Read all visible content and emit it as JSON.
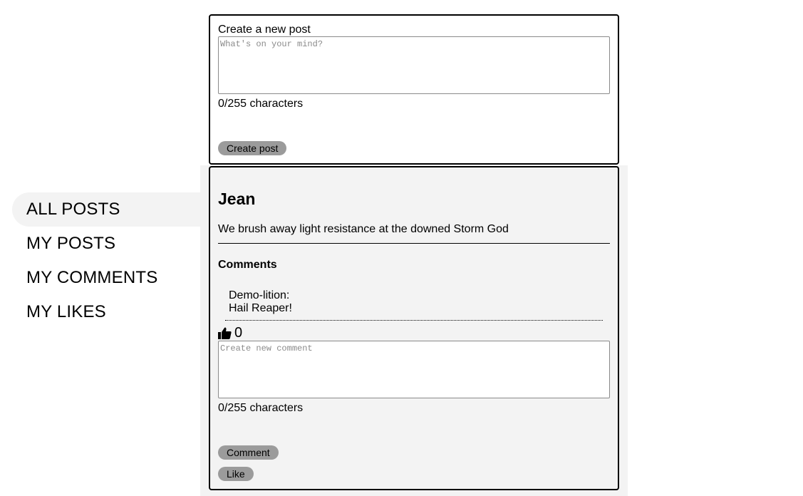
{
  "nav": {
    "items": [
      {
        "label": "ALL POSTS",
        "active": true
      },
      {
        "label": "MY POSTS",
        "active": false
      },
      {
        "label": "MY COMMENTS",
        "active": false
      },
      {
        "label": "MY LIKES",
        "active": false
      }
    ]
  },
  "create_post": {
    "label": "Create a new post",
    "placeholder": "What's on your mind?",
    "value": "",
    "counter": "0/255 characters",
    "button_label": "Create post"
  },
  "post": {
    "author": "Jean",
    "body": "We brush away light resistance at the downed Storm God",
    "comments_heading": "Comments",
    "comments": [
      {
        "author": "Demo-lition:",
        "text": "Hail Reaper!"
      }
    ],
    "like_icon": "thumbs-up-icon",
    "like_count": "0",
    "comment_placeholder": "Create new comment",
    "comment_value": "",
    "comment_counter": "0/255 characters",
    "comment_button_label": "Comment",
    "like_button_label": "Like"
  },
  "colors": {
    "panel_bg": "#f3f3f3",
    "button_bg": "#9b9b9b",
    "border": "#000000"
  }
}
